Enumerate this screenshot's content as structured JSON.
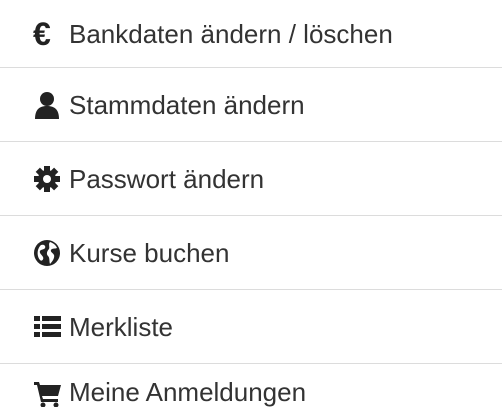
{
  "menu": {
    "items": [
      {
        "label": "Bankdaten ändern / löschen",
        "icon": "euro-icon"
      },
      {
        "label": "Stammdaten ändern",
        "icon": "user-icon"
      },
      {
        "label": "Passwort ändern",
        "icon": "gear-icon"
      },
      {
        "label": "Kurse buchen",
        "icon": "globe-icon"
      },
      {
        "label": "Merkliste",
        "icon": "list-icon"
      },
      {
        "label": "Meine Anmeldungen",
        "icon": "cart-icon"
      }
    ]
  },
  "colors": {
    "text": "#333333",
    "icon": "#222222",
    "divider": "#dcdcdc",
    "background": "#ffffff"
  }
}
